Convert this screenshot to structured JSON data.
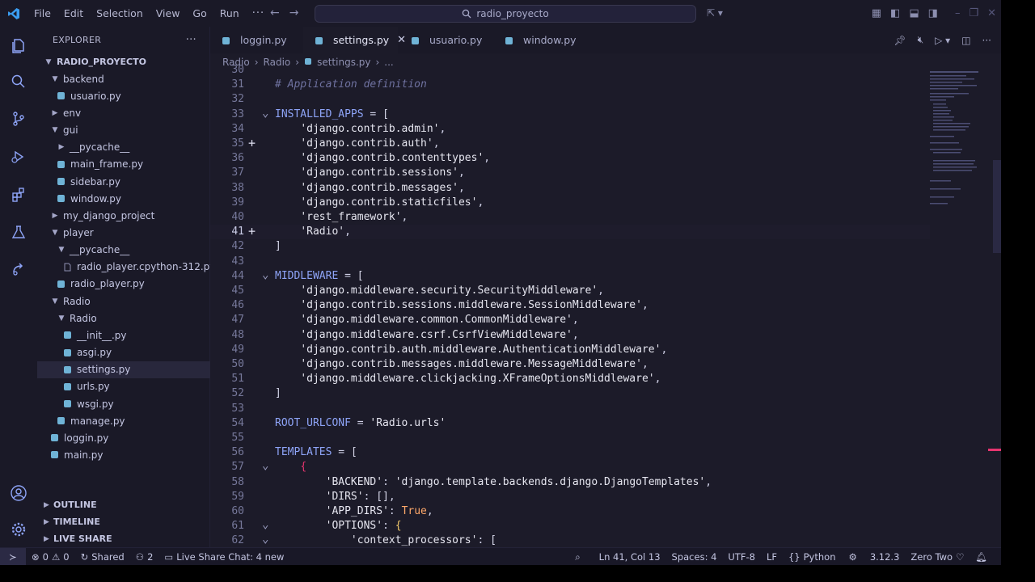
{
  "menu": [
    "File",
    "Edit",
    "Selection",
    "View",
    "Go",
    "Run"
  ],
  "menu_more": "···",
  "command_center": "radio_proyecto",
  "explorer": {
    "title": "EXPLORER",
    "more": "···",
    "tree": [
      {
        "label": "RADIO_PROYECTO",
        "depth": 0,
        "kind": "root"
      },
      {
        "label": "backend",
        "depth": 1,
        "kind": "folder-open"
      },
      {
        "label": "usuario.py",
        "depth": 2,
        "kind": "py"
      },
      {
        "label": "env",
        "depth": 1,
        "kind": "folder"
      },
      {
        "label": "gui",
        "depth": 1,
        "kind": "folder-open"
      },
      {
        "label": "__pycache__",
        "depth": 2,
        "kind": "folder"
      },
      {
        "label": "main_frame.py",
        "depth": 2,
        "kind": "py"
      },
      {
        "label": "sidebar.py",
        "depth": 2,
        "kind": "py"
      },
      {
        "label": "window.py",
        "depth": 2,
        "kind": "py"
      },
      {
        "label": "my_django_project",
        "depth": 1,
        "kind": "folder"
      },
      {
        "label": "player",
        "depth": 1,
        "kind": "folder-open"
      },
      {
        "label": "__pycache__",
        "depth": 2,
        "kind": "folder-open"
      },
      {
        "label": "radio_player.cpython-312.pyc",
        "depth": 3,
        "kind": "file"
      },
      {
        "label": "radio_player.py",
        "depth": 2,
        "kind": "py"
      },
      {
        "label": "Radio",
        "depth": 1,
        "kind": "folder-open"
      },
      {
        "label": "Radio",
        "depth": 2,
        "kind": "folder-open"
      },
      {
        "label": "__init__.py",
        "depth": 3,
        "kind": "py"
      },
      {
        "label": "asgi.py",
        "depth": 3,
        "kind": "py"
      },
      {
        "label": "settings.py",
        "depth": 3,
        "kind": "py",
        "selected": true
      },
      {
        "label": "urls.py",
        "depth": 3,
        "kind": "py"
      },
      {
        "label": "wsgi.py",
        "depth": 3,
        "kind": "py"
      },
      {
        "label": "manage.py",
        "depth": 2,
        "kind": "py"
      },
      {
        "label": "loggin.py",
        "depth": 1,
        "kind": "py"
      },
      {
        "label": "main.py",
        "depth": 1,
        "kind": "py"
      }
    ],
    "sections": [
      "OUTLINE",
      "TIMELINE",
      "LIVE SHARE"
    ]
  },
  "tabs": [
    {
      "label": "loggin.py",
      "active": false
    },
    {
      "label": "settings.py",
      "active": true
    },
    {
      "label": "usuario.py",
      "active": false
    },
    {
      "label": "window.py",
      "active": false
    }
  ],
  "breadcrumbs": [
    "Radio",
    "Radio",
    "settings.py",
    "..."
  ],
  "code": [
    {
      "n": "30",
      "text": ""
    },
    {
      "n": "31",
      "text": "# Application definition",
      "style": "com"
    },
    {
      "n": "32",
      "text": ""
    },
    {
      "n": "33",
      "text": "INSTALLED_APPS = [",
      "fold": true,
      "style": "assign"
    },
    {
      "n": "34",
      "text": "    'django.contrib.admin',"
    },
    {
      "n": "35",
      "text": "    'django.contrib.auth',",
      "plus": true
    },
    {
      "n": "36",
      "text": "    'django.contrib.contenttypes',"
    },
    {
      "n": "37",
      "text": "    'django.contrib.sessions',"
    },
    {
      "n": "38",
      "text": "    'django.contrib.messages',"
    },
    {
      "n": "39",
      "text": "    'django.contrib.staticfiles',"
    },
    {
      "n": "40",
      "text": "    'rest_framework',"
    },
    {
      "n": "41",
      "text": "    'Radio',",
      "plus": true,
      "current": true
    },
    {
      "n": "42",
      "text": "]"
    },
    {
      "n": "43",
      "text": ""
    },
    {
      "n": "44",
      "text": "MIDDLEWARE = [",
      "fold": true,
      "style": "assign"
    },
    {
      "n": "45",
      "text": "    'django.middleware.security.SecurityMiddleware',"
    },
    {
      "n": "46",
      "text": "    'django.contrib.sessions.middleware.SessionMiddleware',"
    },
    {
      "n": "47",
      "text": "    'django.middleware.common.CommonMiddleware',"
    },
    {
      "n": "48",
      "text": "    'django.middleware.csrf.CsrfViewMiddleware',"
    },
    {
      "n": "49",
      "text": "    'django.contrib.auth.middleware.AuthenticationMiddleware',"
    },
    {
      "n": "50",
      "text": "    'django.contrib.messages.middleware.MessageMiddleware',"
    },
    {
      "n": "51",
      "text": "    'django.middleware.clickjacking.XFrameOptionsMiddleware',"
    },
    {
      "n": "52",
      "text": "]"
    },
    {
      "n": "53",
      "text": ""
    },
    {
      "n": "54",
      "text": "ROOT_URLCONF = 'Radio.urls'",
      "style": "assign"
    },
    {
      "n": "55",
      "text": ""
    },
    {
      "n": "56",
      "text": "TEMPLATES = [",
      "style": "assign"
    },
    {
      "n": "57",
      "text": "    {",
      "fold": true,
      "style": "brace"
    },
    {
      "n": "58",
      "text": "        'BACKEND': 'django.template.backends.django.DjangoTemplates',"
    },
    {
      "n": "59",
      "text": "        'DIRS': [],"
    },
    {
      "n": "60",
      "text": "        'APP_DIRS': True,",
      "style": "kw"
    },
    {
      "n": "61",
      "text": "        'OPTIONS': {",
      "fold": true
    },
    {
      "n": "62",
      "text": "            'context_processors': [",
      "fold": true
    }
  ],
  "status": {
    "errors": "0",
    "warnings": "0",
    "shared": "Shared",
    "participants": "2",
    "chat": "Live Share Chat: 4 new",
    "position": "Ln 41, Col 13",
    "spaces": "Spaces: 4",
    "encoding": "UTF-8",
    "eol": "LF",
    "language": "Python",
    "python_version": "3.12.3",
    "theme": "Zero Two"
  },
  "colors": {
    "editor_bg": "#1c1b29",
    "sidebar_bg": "#1a1927",
    "accent": "#8ea4f7",
    "python_icon": "#6fb3d6",
    "brace": "#e7356f"
  }
}
